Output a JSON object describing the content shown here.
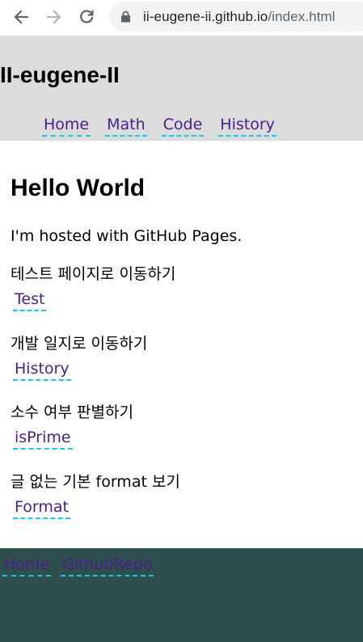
{
  "browser": {
    "url_domain": "ii-eugene-ii.github.io",
    "url_path": "/index.html"
  },
  "header": {
    "site_title": "II-eugene-II",
    "nav": [
      "Home",
      "Math",
      "Code",
      "History"
    ]
  },
  "main": {
    "title": "Hello World",
    "intro": "I'm hosted with GitHub Pages.",
    "entries": [
      {
        "text": "테스트 페이지로 이동하기",
        "link": "Test"
      },
      {
        "text": "개발 일지로 이동하기",
        "link": "History"
      },
      {
        "text": "소수 여부 판별하기",
        "link": "isPrime"
      },
      {
        "text": "글 없는 기본 format 보기",
        "link": "Format"
      }
    ]
  },
  "footer": {
    "links": [
      "Home",
      "GithubRepo"
    ]
  },
  "colors": {
    "header_bg": "#dcdcdc",
    "footer_bg": "#2f4f4f",
    "link": "#4b1f8a",
    "link_underline": "#19c8e6"
  }
}
